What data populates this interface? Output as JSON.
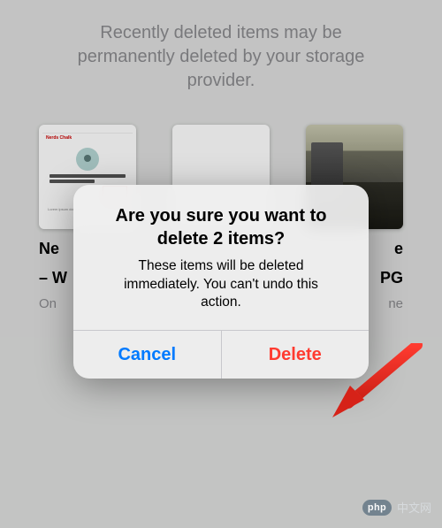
{
  "info_line1": "Recently deleted items may be",
  "info_line2": "permanently deleted by your storage",
  "info_line3": "provider.",
  "thumbs": {
    "left": {
      "caption_a": "Ne",
      "caption_b": "– W",
      "sub": "On"
    },
    "right": {
      "caption_a": "e",
      "caption_b": "PG",
      "sub": "ne"
    }
  },
  "alert": {
    "title_a": "Are you sure you want to",
    "title_b": "delete 2 items?",
    "message_a": "These items will be deleted",
    "message_b": "immediately. You can't undo this",
    "message_c": "action.",
    "cancel": "Cancel",
    "delete": "Delete"
  },
  "watermark": {
    "badge": "php",
    "text": "中文网"
  }
}
